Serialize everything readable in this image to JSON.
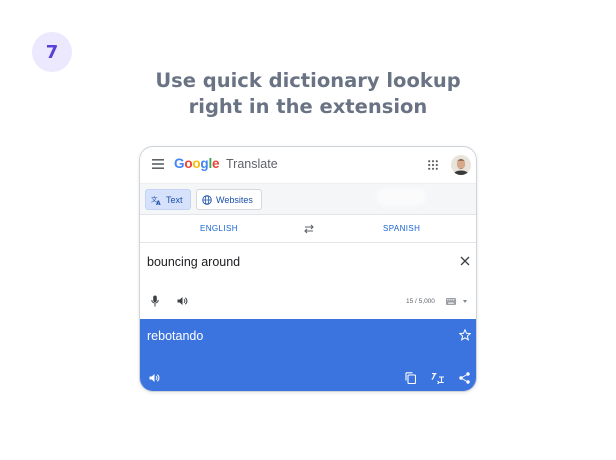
{
  "step": {
    "number": "7"
  },
  "headline": {
    "line1": "Use quick dictionary lookup",
    "line2": "right in the extension"
  },
  "app": {
    "logo_letters": [
      "G",
      "o",
      "o",
      "g",
      "l",
      "e"
    ],
    "logo_colors": [
      "#4285F4",
      "#EA4335",
      "#FBBC05",
      "#4285F4",
      "#34A853",
      "#EA4335"
    ],
    "product_name": "Translate",
    "icons": {
      "menu": "hamburger-menu-icon",
      "apps": "apps-grid-icon",
      "account": "avatar"
    }
  },
  "modes": {
    "text_label": "Text",
    "websites_label": "Websites",
    "active": "Text"
  },
  "languages": {
    "source": "ENGLISH",
    "target": "SPANISH",
    "swap_icon": "swap-icon"
  },
  "source": {
    "text": "bouncing around",
    "char_count": "15 / 5,000",
    "icons": [
      "clear-icon",
      "mic-icon",
      "speaker-icon",
      "keyboard-icon"
    ]
  },
  "result": {
    "text": "rebotando",
    "icons": [
      "star-icon",
      "speaker-icon",
      "copy-icon",
      "feedback-icon",
      "share-icon"
    ]
  },
  "colors": {
    "accent": "#5b41d6",
    "badge_bg": "#ece8fd",
    "headline": "#6a7384",
    "result_bg": "#3b74df",
    "link_blue": "#1a63d6"
  }
}
